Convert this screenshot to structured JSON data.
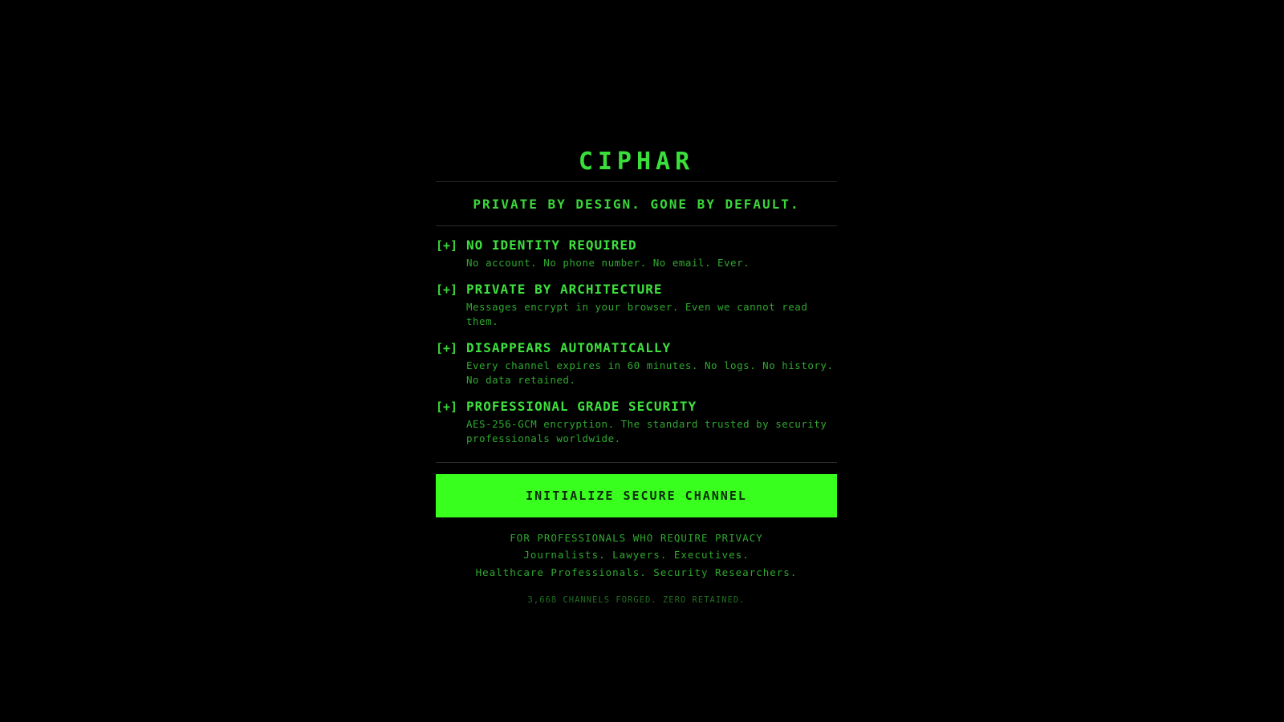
{
  "brand": {
    "logo": "CIPHAR",
    "tagline": "PRIVATE BY DESIGN. GONE BY DEFAULT."
  },
  "features": [
    {
      "bullet": "[+]",
      "title": "NO IDENTITY REQUIRED",
      "description": "No account. No phone number. No email. Ever."
    },
    {
      "bullet": "[+]",
      "title": "PRIVATE BY ARCHITECTURE",
      "description": "Messages encrypt in your browser. Even we cannot read them."
    },
    {
      "bullet": "[+]",
      "title": "DISAPPEARS AUTOMATICALLY",
      "description": "Every channel expires in 60 minutes. No logs. No history. No data retained."
    },
    {
      "bullet": "[+]",
      "title": "PROFESSIONAL GRADE SECURITY",
      "description": "AES-256-GCM encryption. The standard trusted by security professionals worldwide."
    }
  ],
  "cta": {
    "label": "INITIALIZE SECURE CHANNEL"
  },
  "footer": {
    "heading": "FOR PROFESSIONALS WHO REQUIRE PRIVACY",
    "line1": "Journalists. Lawyers. Executives.",
    "line2": "Healthcare Professionals. Security Researchers.",
    "stats": "3,668 CHANNELS FORGED. ZERO RETAINED."
  },
  "colors": {
    "background": "#000000",
    "accent": "#39ff1f",
    "text": "#3ddc3a",
    "muted": "#2fa82f",
    "dim": "#1f6e1f"
  }
}
